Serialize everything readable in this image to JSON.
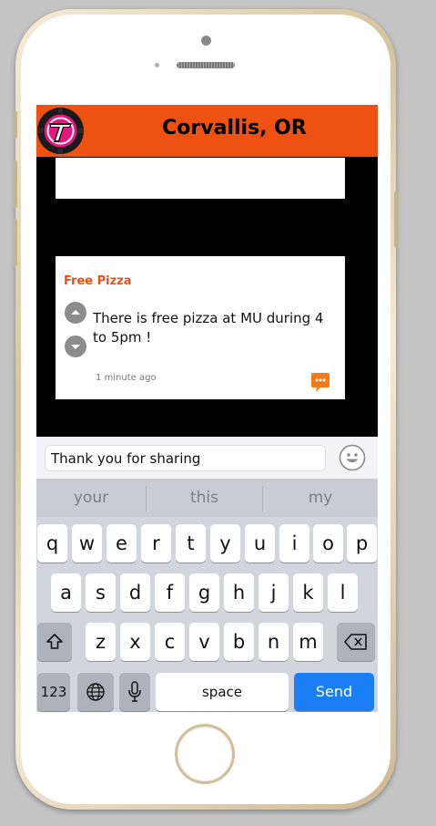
{
  "header": {
    "title": "Corvallis, OR",
    "logo_icon": "logo-t-icon",
    "color": "#ef5113"
  },
  "post": {
    "title": "Free Pizza",
    "body": "There is free pizza at MU during 4 to 5pm !",
    "time": "1 minute ago",
    "icons": {
      "upvote": "chevron-up-icon",
      "downvote": "chevron-down-icon",
      "comment": "comment-bubble-icon"
    }
  },
  "compose": {
    "value": "Thank you for sharing",
    "emoji_icon": "emoji-icon"
  },
  "keyboard": {
    "suggestions": [
      "your",
      "this",
      "my"
    ],
    "rows": [
      [
        "q",
        "w",
        "e",
        "r",
        "t",
        "y",
        "u",
        "i",
        "o",
        "p"
      ],
      [
        "a",
        "s",
        "d",
        "f",
        "g",
        "h",
        "j",
        "k",
        "l"
      ],
      [
        "z",
        "x",
        "c",
        "v",
        "b",
        "n",
        "m"
      ]
    ],
    "numbers_label": "123",
    "space_label": "space",
    "send_label": "Send",
    "send_color": "#1a7ff4"
  }
}
